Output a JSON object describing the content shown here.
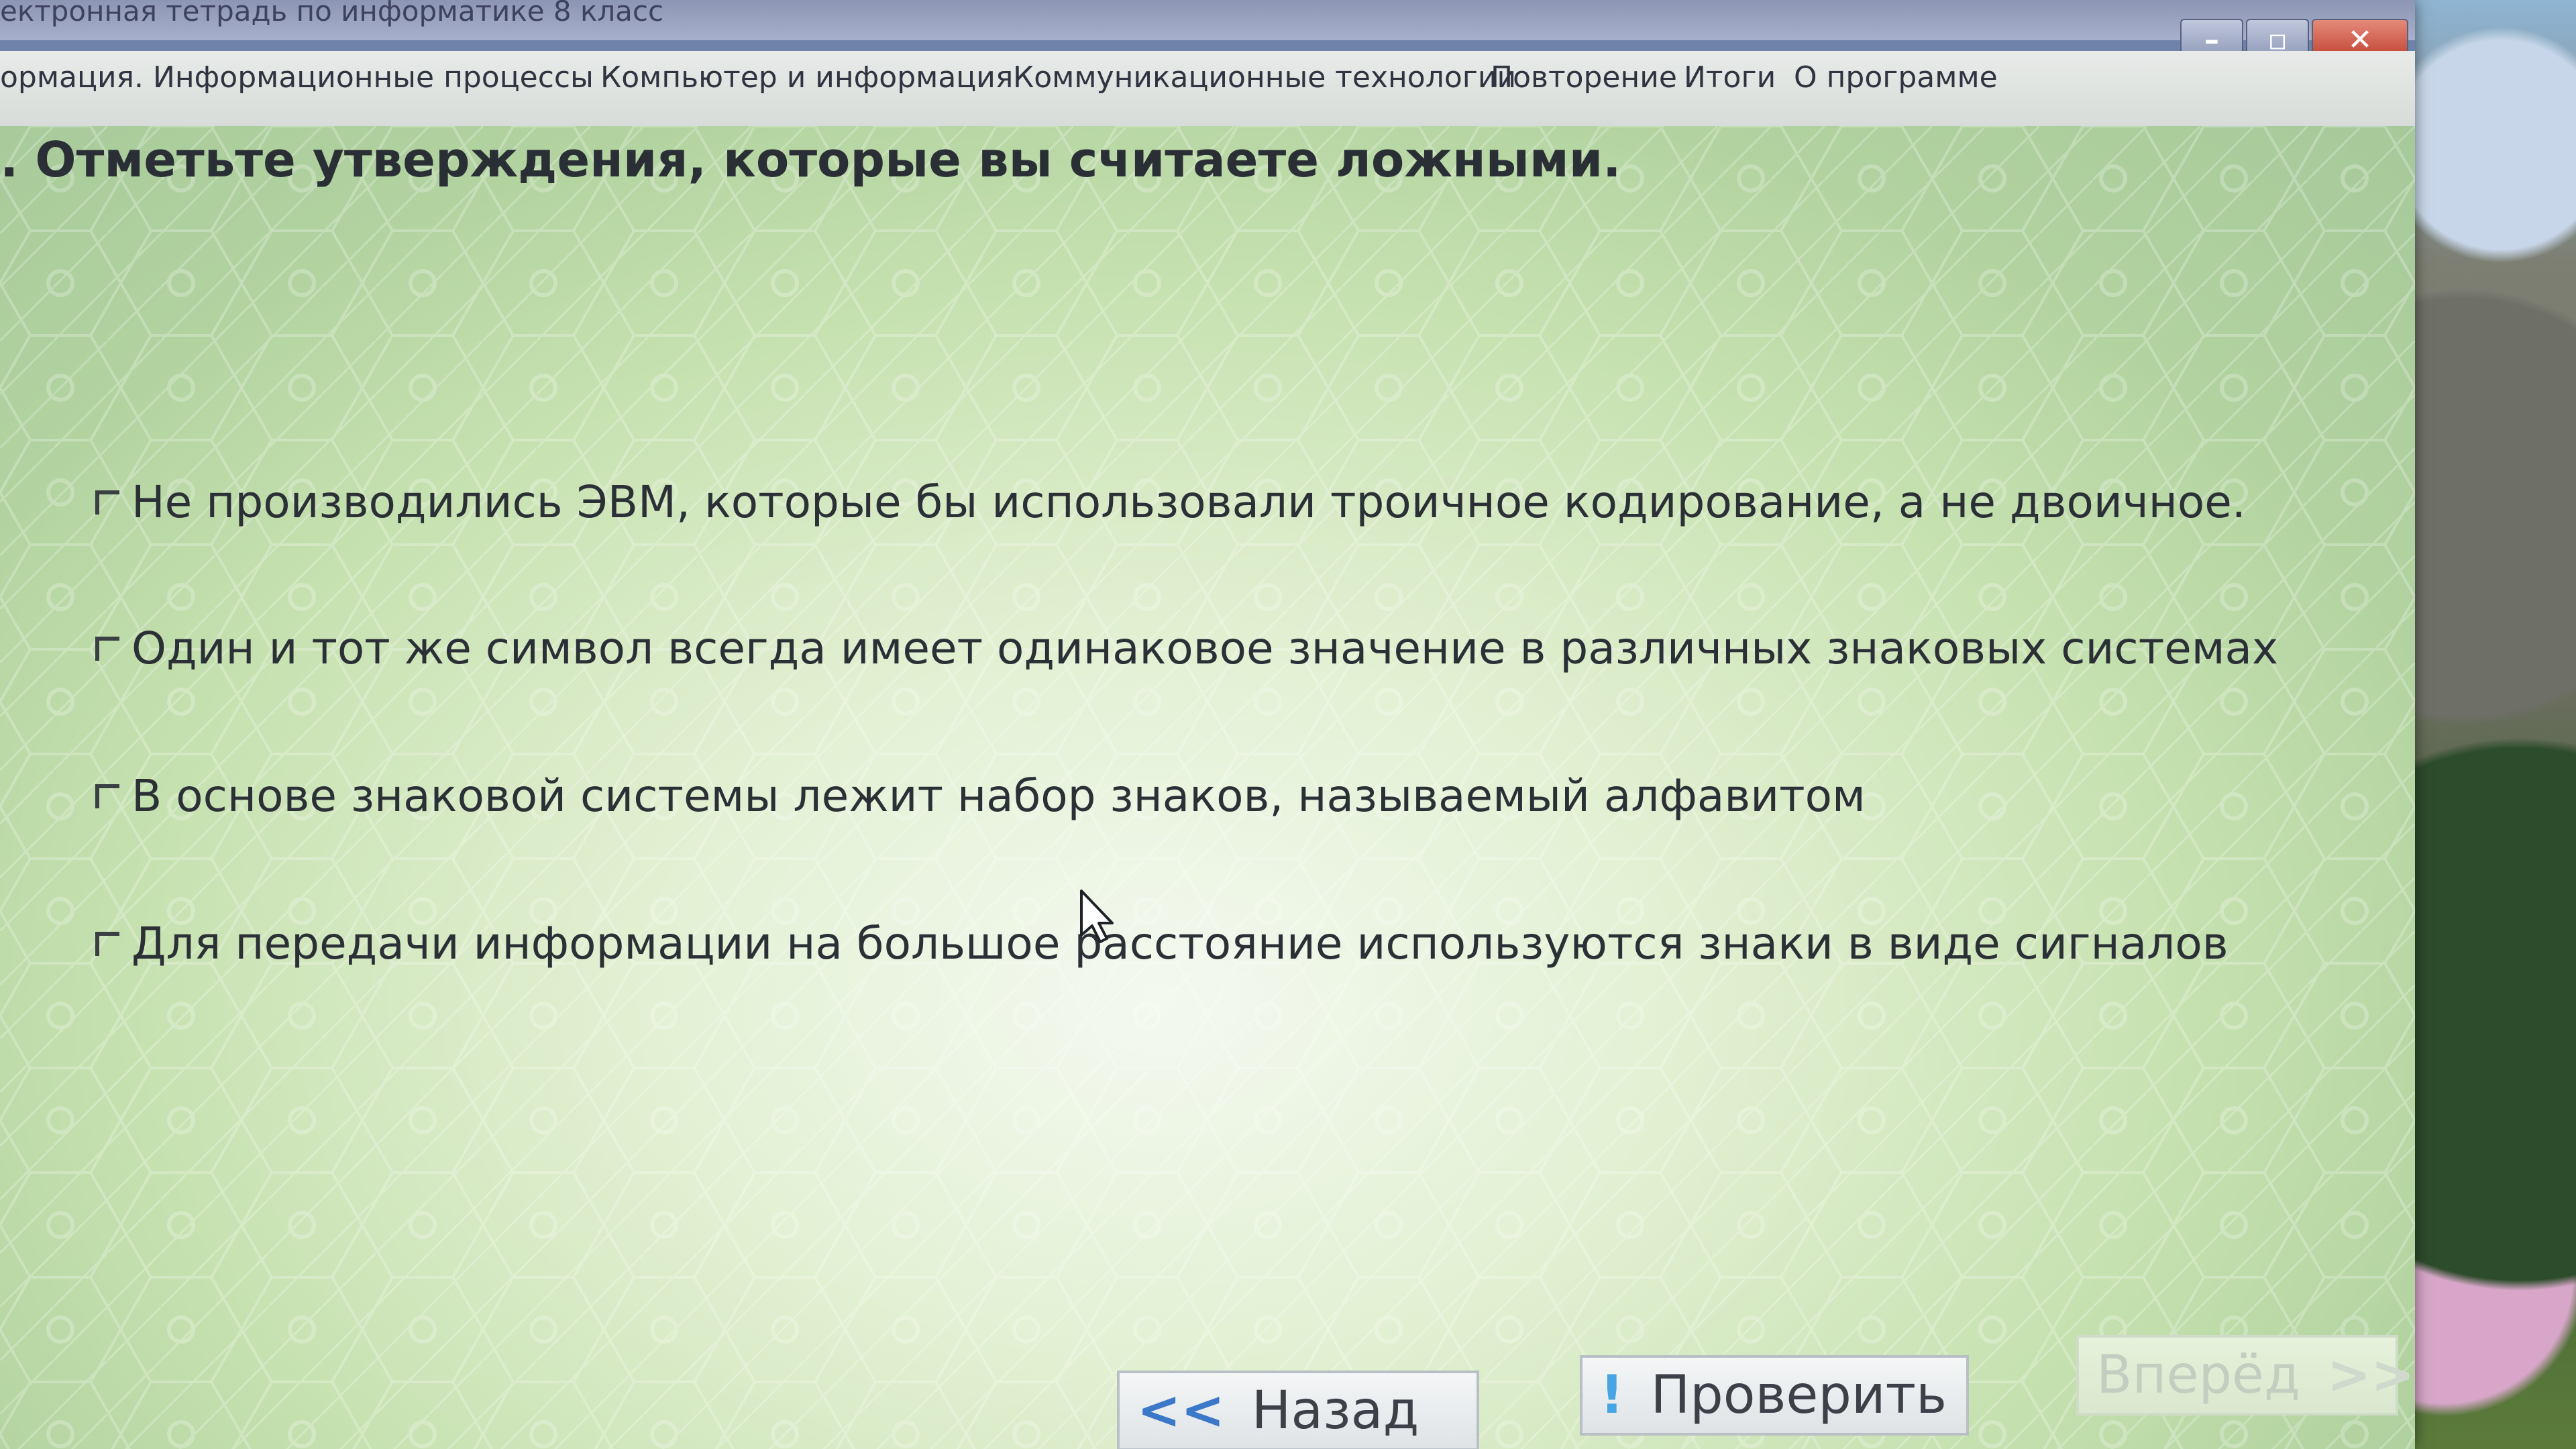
{
  "window": {
    "title": "ектронная тетрадь по информатике 8 класс",
    "controls": [
      "–",
      "▫",
      "✕"
    ]
  },
  "menu": [
    "ормация. Информационные процессы",
    "Компьютер и информация",
    "Коммуникационные технологии",
    "Повторение",
    "Итоги",
    "О программе"
  ],
  "question": ". Отметьте утверждения, которые вы считаете ложными.",
  "options": [
    "Не производились ЭВМ, которые бы использовали троичное кодирование, а не двоичное.",
    "Один и тот же символ всегда имеет одинаковое значение в различных знаковых системах",
    "В основе знаковой системы лежит набор знаков, называемый алфавитом",
    "Для передачи информации на большое расстояние используются знаки в виде сигналов"
  ],
  "buttons": {
    "back": {
      "label": "Назад",
      "icon": "<<"
    },
    "check": {
      "label": "Проверить",
      "icon": "!"
    },
    "forward": {
      "label": "Вперёд",
      "icon": ">>"
    }
  },
  "icons": {
    "cursor": "arrow-cursor-icon",
    "back": "double-chevron-left-icon",
    "check": "exclamation-icon",
    "forward": "double-chevron-right-icon"
  },
  "colors": {
    "accent": "#3b78c7",
    "text": "#2b3036",
    "disabled": "#c3cec0"
  }
}
